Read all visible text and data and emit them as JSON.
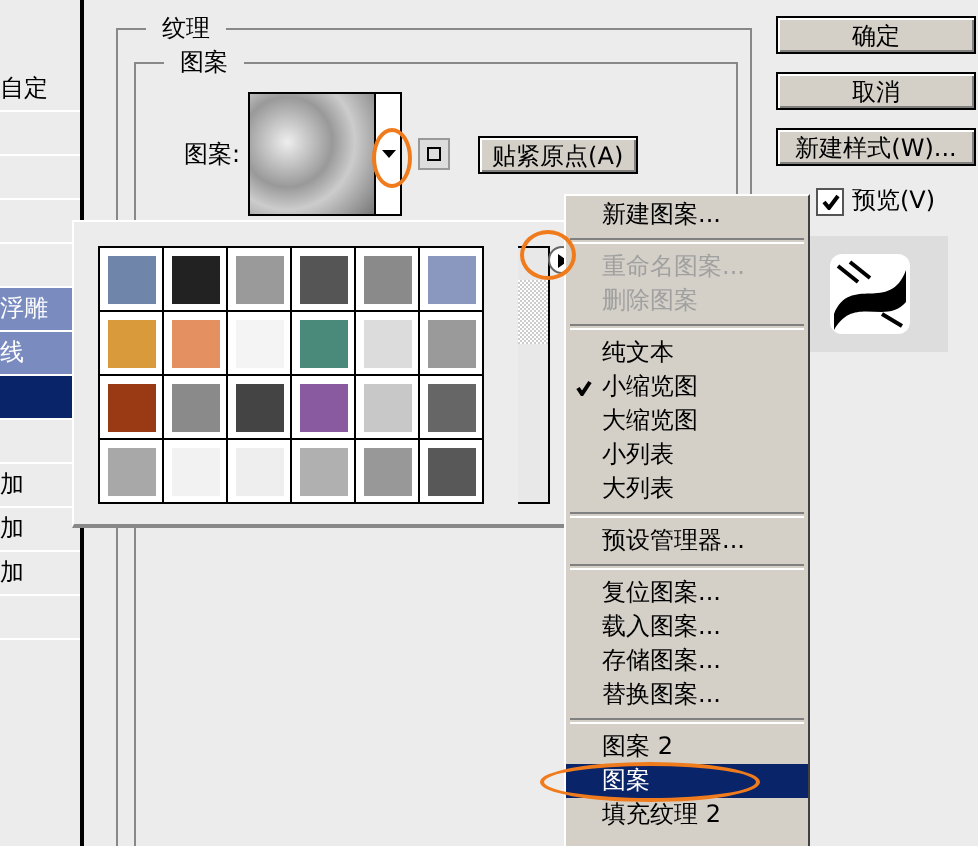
{
  "style_list": {
    "items": [
      {
        "label": "自定",
        "highlighted": false,
        "selected": false
      },
      {
        "highlighted": false,
        "selected": false
      },
      {
        "highlighted": false,
        "selected": false
      },
      {
        "highlighted": false,
        "selected": false
      },
      {
        "highlighted": false,
        "selected": false
      },
      {
        "label": "浮雕",
        "highlighted": true,
        "selected": false
      },
      {
        "label": "线",
        "highlighted": true,
        "selected": false
      },
      {
        "highlighted": false,
        "selected": true
      },
      {
        "highlighted": false,
        "selected": false
      },
      {
        "label": "加",
        "highlighted": false,
        "selected": false
      },
      {
        "label": "加",
        "highlighted": false,
        "selected": false
      },
      {
        "label": "加",
        "highlighted": false,
        "selected": false
      },
      {
        "highlighted": false,
        "selected": false
      }
    ]
  },
  "texture_group": {
    "title": "纹理",
    "pattern_group": {
      "title": "图案",
      "pattern_label": "图案:",
      "snap_button": "贴紧原点(A)"
    }
  },
  "buttons": [
    "确定",
    "取消",
    "新建样式(W)..."
  ],
  "preview": {
    "label": "预览(V)",
    "checked": true
  },
  "pattern_picker": {
    "swatches": [
      {
        "color": "#6f86aa"
      },
      {
        "color": "#222222"
      },
      {
        "color": "#9a9a9a"
      },
      {
        "color": "#555555"
      },
      {
        "color": "#8a8a8a"
      },
      {
        "color": "#8a98c0"
      },
      {
        "color": "#d89a3a"
      },
      {
        "color": "#e49060"
      },
      {
        "color": "#f4f4f4"
      },
      {
        "color": "#4a8a7a"
      },
      {
        "color": "#dcdcdc"
      },
      {
        "color": "#9a9a9a"
      },
      {
        "color": "#9a3a14"
      },
      {
        "color": "#8a8a8a"
      },
      {
        "color": "#444444"
      },
      {
        "color": "#8a5aa0"
      },
      {
        "color": "#c8c8c8"
      },
      {
        "color": "#666666"
      },
      {
        "color": "#a8a8a8"
      },
      {
        "color": "#f2f2f2"
      },
      {
        "color": "#eeeeee"
      },
      {
        "color": "#b0b0b0"
      },
      {
        "color": "#989898"
      },
      {
        "color": "#585858"
      }
    ]
  },
  "menu": {
    "items": [
      {
        "kind": "item",
        "label": "新建图案...",
        "disabled": false,
        "checked": false,
        "selected": false
      },
      {
        "kind": "separator"
      },
      {
        "kind": "item",
        "label": "重命名图案...",
        "disabled": true,
        "checked": false,
        "selected": false
      },
      {
        "kind": "item",
        "label": "删除图案",
        "disabled": true,
        "checked": false,
        "selected": false
      },
      {
        "kind": "separator"
      },
      {
        "kind": "item",
        "label": "纯文本",
        "disabled": false,
        "checked": false,
        "selected": false
      },
      {
        "kind": "item",
        "label": "小缩览图",
        "disabled": false,
        "checked": true,
        "selected": false
      },
      {
        "kind": "item",
        "label": "大缩览图",
        "disabled": false,
        "checked": false,
        "selected": false
      },
      {
        "kind": "item",
        "label": "小列表",
        "disabled": false,
        "checked": false,
        "selected": false
      },
      {
        "kind": "item",
        "label": "大列表",
        "disabled": false,
        "checked": false,
        "selected": false
      },
      {
        "kind": "separator"
      },
      {
        "kind": "item",
        "label": "预设管理器...",
        "disabled": false,
        "checked": false,
        "selected": false
      },
      {
        "kind": "separator"
      },
      {
        "kind": "item",
        "label": "复位图案...",
        "disabled": false,
        "checked": false,
        "selected": false
      },
      {
        "kind": "item",
        "label": "载入图案...",
        "disabled": false,
        "checked": false,
        "selected": false
      },
      {
        "kind": "item",
        "label": "存储图案...",
        "disabled": false,
        "checked": false,
        "selected": false
      },
      {
        "kind": "item",
        "label": "替换图案...",
        "disabled": false,
        "checked": false,
        "selected": false
      },
      {
        "kind": "separator"
      },
      {
        "kind": "item",
        "label": "图案 2",
        "disabled": false,
        "checked": false,
        "selected": false
      },
      {
        "kind": "item",
        "label": "图案",
        "disabled": false,
        "checked": false,
        "selected": true
      },
      {
        "kind": "item",
        "label": "填充纹理 2",
        "disabled": false,
        "checked": false,
        "selected": false
      }
    ]
  }
}
